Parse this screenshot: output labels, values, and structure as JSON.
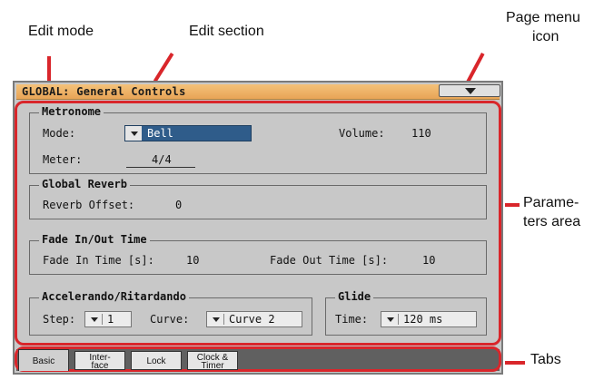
{
  "callouts": {
    "edit_mode": "Edit mode",
    "edit_section": "Edit section",
    "page_menu_line1": "Page menu",
    "page_menu_line2": "icon",
    "params_line1": "Parame-",
    "params_line2": "ters area",
    "tabs": "Tabs"
  },
  "header": {
    "title": "GLOBAL: General Controls"
  },
  "metronome": {
    "title": "Metronome",
    "mode_label": "Mode:",
    "mode_value": "Bell",
    "volume_label": "Volume:",
    "volume_value": "110",
    "meter_label": "Meter:",
    "meter_value": "4/4"
  },
  "global_reverb": {
    "title": "Global Reverb",
    "offset_label": "Reverb Offset:",
    "offset_value": "0"
  },
  "fade": {
    "title": "Fade In/Out Time",
    "in_label": "Fade In Time [s]:",
    "in_value": "10",
    "out_label": "Fade Out Time [s]:",
    "out_value": "10"
  },
  "accel": {
    "title": "Accelerando/Ritardando",
    "step_label": "Step:",
    "step_value": "1",
    "curve_label": "Curve:",
    "curve_value": "Curve 2"
  },
  "glide": {
    "title": "Glide",
    "time_label": "Time:",
    "time_value": "120 ms"
  },
  "tabs": [
    {
      "line1": "Basic",
      "line2": ""
    },
    {
      "line1": "Inter-",
      "line2": "face"
    },
    {
      "line1": "Lock",
      "line2": ""
    },
    {
      "line1": "Clock &",
      "line2": "Timer"
    }
  ],
  "colors": {
    "accent": "#d9262b",
    "title_bar": "#f0b46a",
    "selected": "#2f5c8a"
  }
}
